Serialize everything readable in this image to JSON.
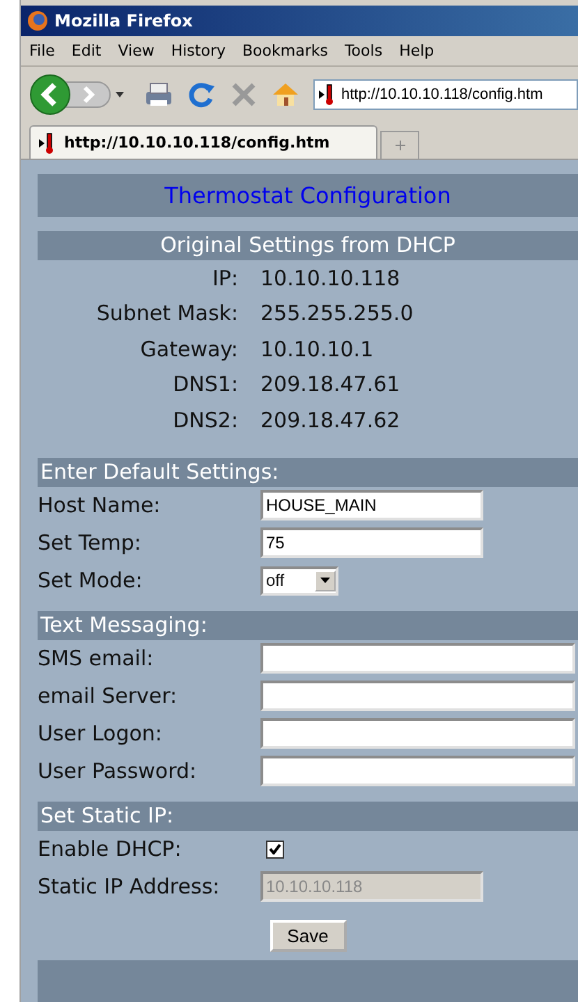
{
  "window": {
    "title": "Mozilla Firefox"
  },
  "menu": [
    "File",
    "Edit",
    "View",
    "History",
    "Bookmarks",
    "Tools",
    "Help"
  ],
  "address_bar": {
    "value": "http://10.10.10.118/config.htm"
  },
  "tabs": [
    {
      "label": "http://10.10.10.118/config.htm",
      "selected": true
    }
  ],
  "page": {
    "title": "Thermostat Configuration",
    "dhcp": {
      "heading": "Original Settings from DHCP",
      "rows": [
        {
          "label": "IP:",
          "value": "10.10.10.118"
        },
        {
          "label": "Subnet Mask:",
          "value": "255.255.255.0"
        },
        {
          "label": "Gateway:",
          "value": "10.10.10.1"
        },
        {
          "label": "DNS1:",
          "value": "209.18.47.61"
        },
        {
          "label": "DNS2:",
          "value": "209.18.47.62"
        }
      ]
    },
    "sections": [
      {
        "heading": "Enter Default Settings:",
        "fields": [
          {
            "kind": "text",
            "label": "Host Name:",
            "value": "HOUSE_MAIN",
            "wide": false,
            "disabled": false
          },
          {
            "kind": "text",
            "label": "Set Temp:",
            "value": "75",
            "wide": false,
            "disabled": false
          },
          {
            "kind": "select",
            "label": "Set Mode:",
            "value": "off"
          }
        ]
      },
      {
        "heading": "Text Messaging:",
        "fields": [
          {
            "kind": "text",
            "label": "SMS email:",
            "wide": true,
            "disabled": false
          },
          {
            "kind": "text",
            "label": "email Server:",
            "wide": true,
            "disabled": false
          },
          {
            "kind": "text",
            "label": "User Logon:",
            "wide": true,
            "disabled": false
          },
          {
            "kind": "text",
            "label": "User Password:",
            "wide": true,
            "disabled": false
          }
        ]
      },
      {
        "heading": "Set Static IP:",
        "fields": [
          {
            "kind": "checkbox",
            "label": "Enable DHCP:",
            "checked": true
          },
          {
            "kind": "text",
            "label": "Static IP Address:",
            "value": "10.10.10.118",
            "wide": false,
            "disabled": true
          }
        ]
      }
    ],
    "save_button": "Save"
  }
}
